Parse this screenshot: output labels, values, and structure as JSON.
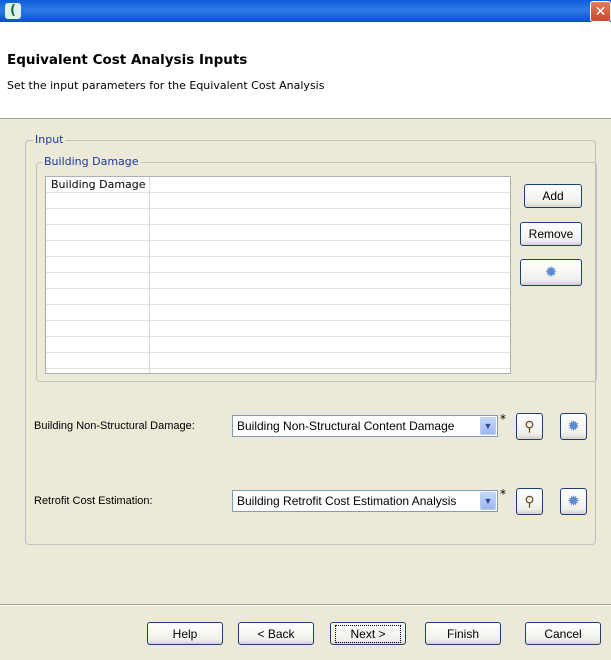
{
  "window": {
    "icon": "app-icon",
    "close_glyph": "✕"
  },
  "header": {
    "title": "Equivalent Cost Analysis Inputs",
    "description": "Set the input parameters for the Equivalent Cost Analysis"
  },
  "input_group": {
    "legend": "Input",
    "building_damage_group": {
      "legend": "Building Damage",
      "table": {
        "column_header": "Building Damage",
        "rows": []
      },
      "add_label": "Add",
      "remove_label": "Remove"
    }
  },
  "fields": {
    "nonstructural": {
      "label": "Building Non-Structural Damage:",
      "value": "Building Non-Structural Content Damage",
      "required_marker": "*"
    },
    "retrofit": {
      "label": "Retrofit Cost Estimation:",
      "value": "Building Retrofit Cost Estimation Analysis",
      "required_marker": "*"
    }
  },
  "buttons": {
    "help": "Help",
    "back": "< Back",
    "next": "Next >",
    "finish": "Finish",
    "cancel": "Cancel"
  },
  "icons": {
    "gear": "gear-icon",
    "search": "magnifier-icon",
    "dropdown": "chevron-down-icon"
  },
  "colors": {
    "titlebar": "#0a5fd8",
    "legend_text": "#1a3a9a",
    "window_bg": "#ece9d8"
  }
}
